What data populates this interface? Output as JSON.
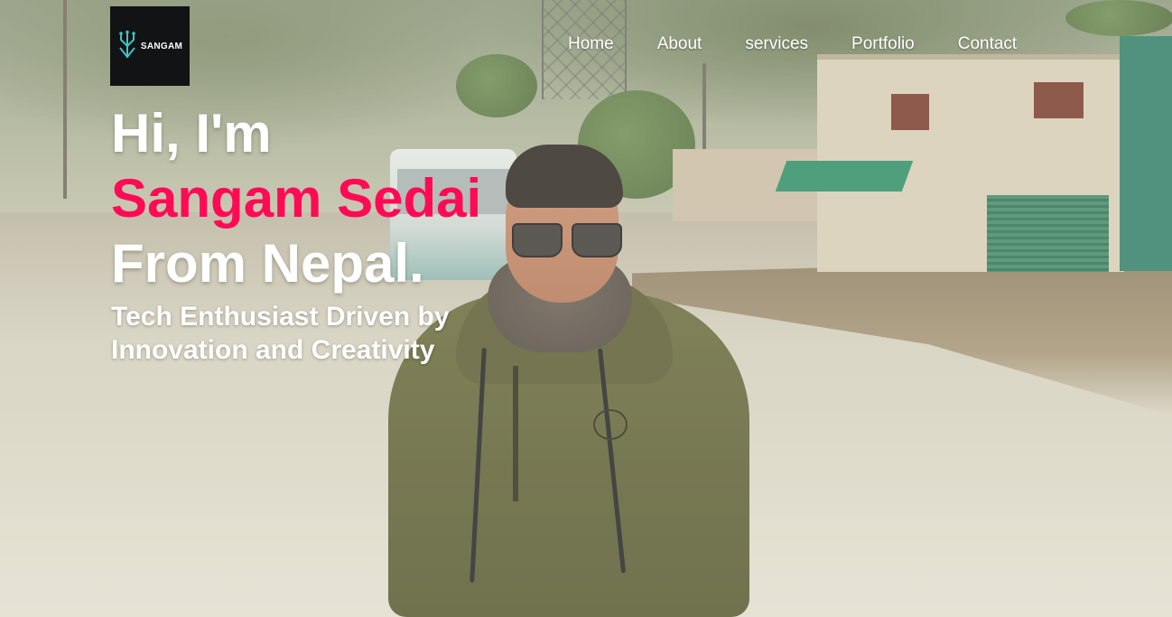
{
  "logo": {
    "text": "SANGAM",
    "icon": "tree-circuit-icon",
    "bg_color": "#111315",
    "icon_color": "#3fc1c9"
  },
  "nav": {
    "items": [
      {
        "label": "Home"
      },
      {
        "label": "About"
      },
      {
        "label": "services"
      },
      {
        "label": "Portfolio"
      },
      {
        "label": "Contact"
      }
    ]
  },
  "hero": {
    "greeting": "Hi, I'm",
    "name": "Sangam Sedai",
    "origin": "From Nepal.",
    "tagline_line1": "Tech Enthusiast Driven by",
    "tagline_line2": "Innovation and Creativity"
  },
  "colors": {
    "accent": "#ff0b55",
    "text": "#ffffff"
  }
}
